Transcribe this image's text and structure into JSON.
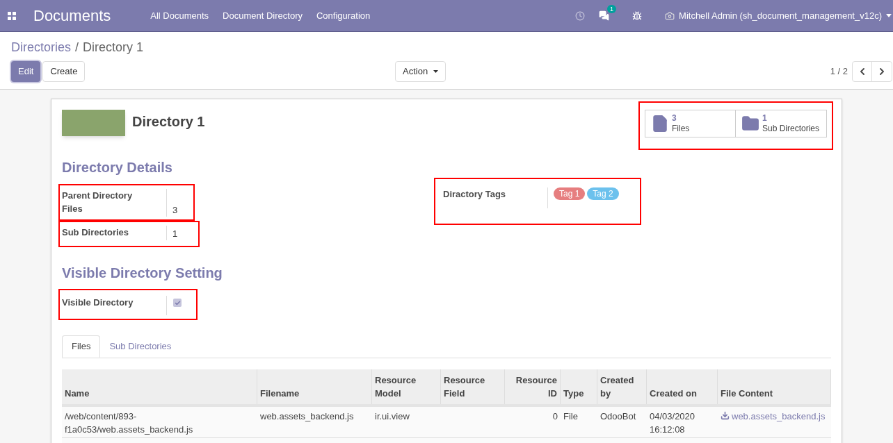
{
  "navbar": {
    "app_title": "Documents",
    "menu": [
      "All Documents",
      "Document Directory",
      "Configuration"
    ],
    "messages_badge": "1",
    "user": "Mitchell Admin (sh_document_management_v12c)"
  },
  "breadcrumb": {
    "separator": "/",
    "items": [
      {
        "label": "Directories",
        "link": true
      },
      {
        "label": "Directory 1",
        "link": false
      }
    ]
  },
  "buttons": [
    {
      "label": "Edit",
      "primary": true
    },
    {
      "label": "Create",
      "primary": false
    }
  ],
  "action_menu": "Action",
  "pager": "1 / 2",
  "record": {
    "title": "Directory 1",
    "smart_buttons": [
      {
        "kind": "file",
        "count": "3",
        "label": "Files"
      },
      {
        "kind": "folder",
        "count": "1",
        "label": "Sub Directories"
      }
    ]
  },
  "directory_details": {
    "heading": "Directory Details",
    "groups": [
      {
        "fields": [
          {
            "label": "Parent Directory"
          },
          {
            "label": "Files",
            "value": "3"
          }
        ]
      },
      {
        "fields": [
          {
            "label": "Sub Directories",
            "value": "1"
          }
        ]
      }
    ],
    "tags_field": {
      "label": "Diractory Tags",
      "tags": [
        {
          "label": "Tag 1",
          "color": "#e67e7f"
        },
        {
          "label": "Tag 2",
          "color": "#6cc1ed"
        }
      ]
    }
  },
  "visible_setting": {
    "heading": "Visible Directory Setting",
    "label": "Visible Directory",
    "checked": true
  },
  "tabs": [
    {
      "label": "Files",
      "selected": true
    },
    {
      "label": "Sub Directories",
      "selected": false
    }
  ],
  "table": {
    "columns": [
      "Name",
      "Filename",
      "Resource Model",
      "Resource Field",
      "Resource ID",
      "Type",
      "Created by",
      "Created on",
      "File Content"
    ],
    "rows": [
      {
        "cells": [
          "/web/content/893-f1a0c53/web.assets_backend.js",
          "web.assets_backend.js",
          "ir.ui.view",
          "",
          "0",
          "File",
          "OdooBot",
          "04/03/2020 16:12:08"
        ],
        "file_content": "web.assets_backend.js"
      },
      {
        "cells": [],
        "file_content": ""
      }
    ]
  }
}
